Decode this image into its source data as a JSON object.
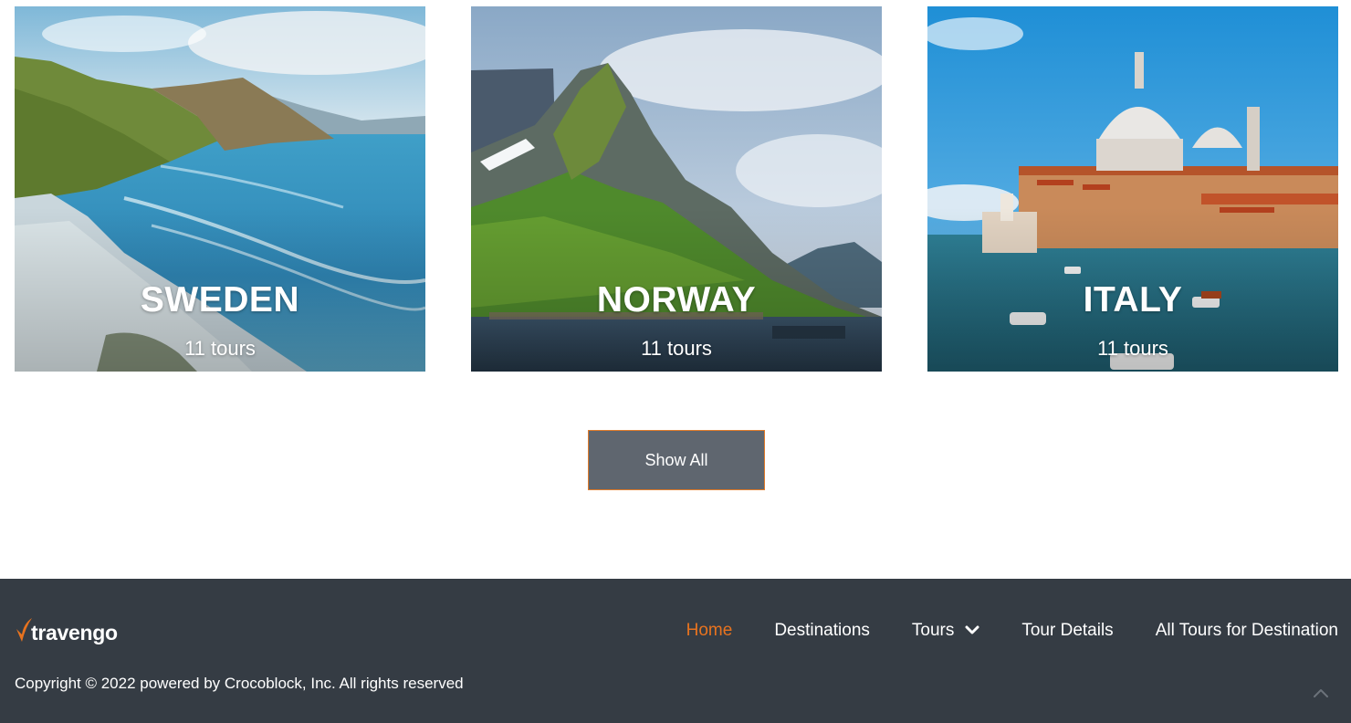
{
  "destinations": [
    {
      "name": "SWEDEN",
      "count": "11 tours"
    },
    {
      "name": "NORWAY",
      "count": "11 tours"
    },
    {
      "name": "ITALY",
      "count": "11 tours"
    }
  ],
  "show_all": {
    "label": "Show All"
  },
  "footer": {
    "logo_text": "travengo",
    "nav": [
      {
        "label": "Home",
        "active": true
      },
      {
        "label": "Destinations"
      },
      {
        "label": "Tours",
        "has_dropdown": true
      },
      {
        "label": "Tour Details"
      },
      {
        "label": "All Tours for Destination"
      }
    ],
    "copyright": "Copyright © 2022 powered by Crocoblock, Inc. All rights reserved"
  },
  "colors": {
    "accent": "#e8731f",
    "footer_bg": "#353c44",
    "button_bg": "#5f666f",
    "button_border": "#e07b2a"
  },
  "icons": {
    "logo_mark": "check-swoosh-icon",
    "dropdown": "chevron-down-icon",
    "scroll_top": "chevron-up-icon"
  }
}
